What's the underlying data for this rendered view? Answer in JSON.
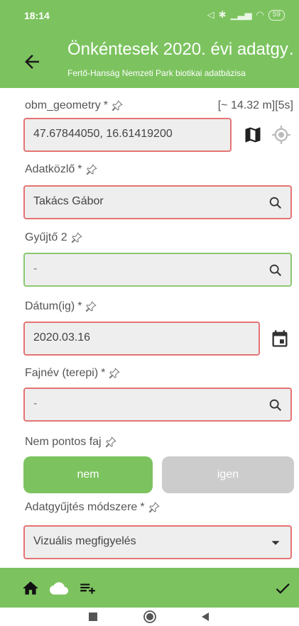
{
  "status": {
    "time": "18:14",
    "battery": "59"
  },
  "app": {
    "title": "Önkéntesek 2020. évi adatgy…",
    "subtitle": "Fertő-Hanság Nemzeti Park biotikai adatbázisa"
  },
  "accuracy": "[~ 14.32 m][5s]",
  "fields": {
    "geometry": {
      "label": "obm_geometry",
      "required": " *",
      "value": "47.67844050, 16.61419200"
    },
    "reporter": {
      "label": "Adatközlő",
      "required": " *",
      "value": "Takács Gábor"
    },
    "collector2": {
      "label": "Gyűjtő 2",
      "required": "",
      "value": "-"
    },
    "date": {
      "label": "Dátum(ig)",
      "required": " *",
      "value": "2020.03.16"
    },
    "species": {
      "label": "Fajnév (terepi)",
      "required": " *",
      "value": "-"
    },
    "inexact": {
      "label": "Nem pontos faj",
      "required": "",
      "no_label": "nem",
      "yes_label": "igen"
    },
    "method": {
      "label": "Adatgyűjtés módszere",
      "required": " *",
      "value": "Vizuális megfigyelés"
    }
  },
  "colors": {
    "primary": "#7cc35f",
    "invalid": "#e57373",
    "valid": "#8bc972",
    "field_bg": "#eeeeee"
  }
}
